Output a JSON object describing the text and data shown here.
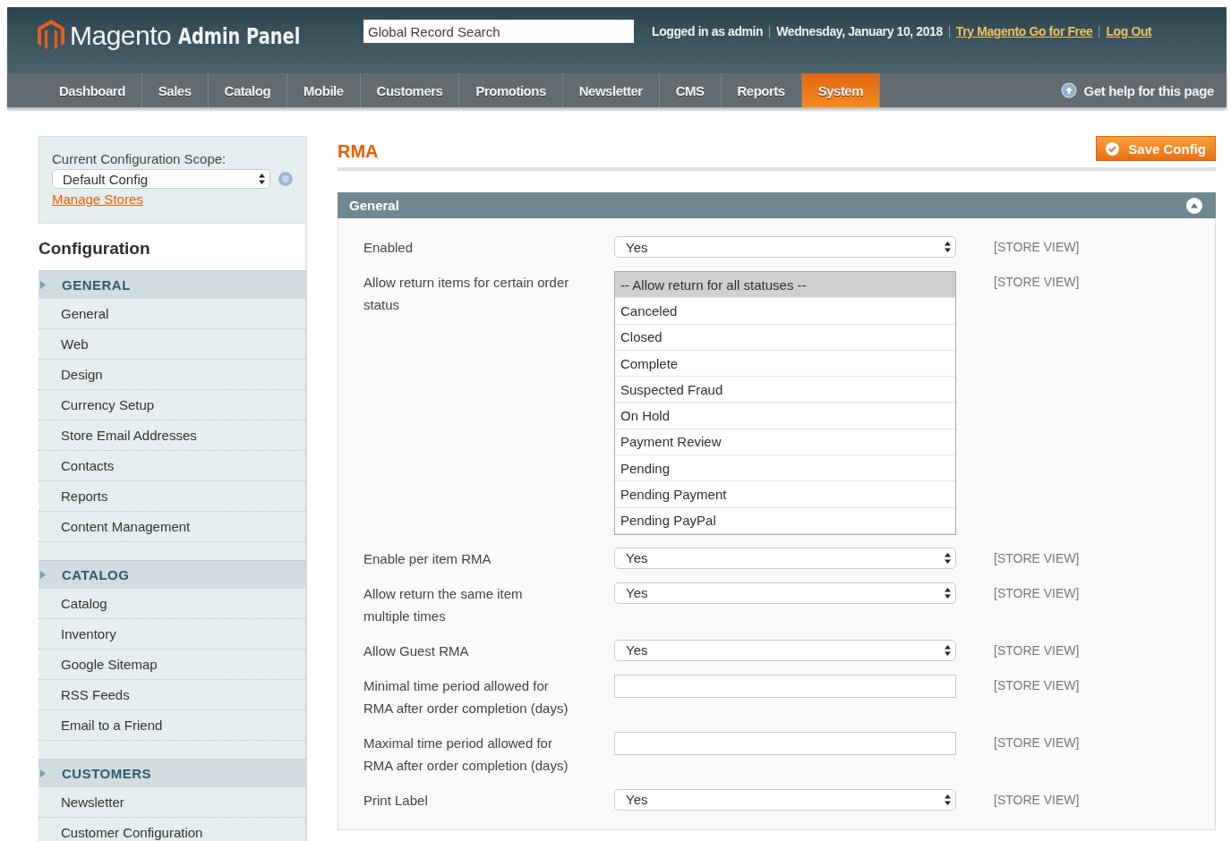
{
  "header": {
    "logo_word": "Magento",
    "logo_suffix": "Admin Panel",
    "search": {
      "placeholder": "Global Record Search"
    },
    "user": "Logged in as admin",
    "date": "Wednesday, January 10, 2018",
    "links": [
      "Try Magento Go for Free",
      "Log Out"
    ]
  },
  "nav": {
    "items": [
      {
        "label": "Dashboard",
        "selected": false
      },
      {
        "label": "Sales",
        "selected": false
      },
      {
        "label": "Catalog",
        "selected": false
      },
      {
        "label": "Mobile",
        "selected": false
      },
      {
        "label": "Customers",
        "selected": false
      },
      {
        "label": "Promotions",
        "selected": false
      },
      {
        "label": "Newsletter",
        "selected": false
      },
      {
        "label": "CMS",
        "selected": false
      },
      {
        "label": "Reports",
        "selected": false
      },
      {
        "label": "System",
        "selected": true
      }
    ],
    "help": "Get help for this page"
  },
  "sidebar": {
    "scope_label": "Current Configuration Scope:",
    "scope_value": "Default Config",
    "manage_link": "Manage Stores",
    "title": "Configuration",
    "sections": [
      {
        "title": "GENERAL",
        "items": [
          "General",
          "Web",
          "Design",
          "Currency Setup",
          "Store Email Addresses",
          "Contacts",
          "Reports",
          "Content Management"
        ]
      },
      {
        "title": "CATALOG",
        "items": [
          "Catalog",
          "Inventory",
          "Google Sitemap",
          "RSS Feeds",
          "Email to a Friend"
        ]
      },
      {
        "title": "CUSTOMERS",
        "items": [
          "Newsletter",
          "Customer Configuration"
        ]
      }
    ]
  },
  "page": {
    "title": "RMA",
    "save_button": "Save Config",
    "section": {
      "title": "General",
      "rows": [
        {
          "label": "Enabled",
          "kind": "select",
          "value": "Yes",
          "scope": "[STORE VIEW]"
        },
        {
          "label": "Allow return items for certain order status",
          "kind": "multiselect",
          "options": [
            {
              "label": "-- Allow return for all statuses --",
              "selected": true
            },
            {
              "label": "Canceled",
              "selected": false
            },
            {
              "label": "Closed",
              "selected": false
            },
            {
              "label": "Complete",
              "selected": false
            },
            {
              "label": "Suspected Fraud",
              "selected": false
            },
            {
              "label": "On Hold",
              "selected": false
            },
            {
              "label": "Payment Review",
              "selected": false
            },
            {
              "label": "Pending",
              "selected": false
            },
            {
              "label": "Pending Payment",
              "selected": false
            },
            {
              "label": "Pending PayPal",
              "selected": false
            }
          ],
          "scope": "[STORE VIEW]"
        },
        {
          "label": "Enable per item RMA",
          "kind": "select",
          "value": "Yes",
          "scope": "[STORE VIEW]"
        },
        {
          "label": "Allow return the same item multiple times",
          "kind": "select",
          "value": "Yes",
          "scope": "[STORE VIEW]"
        },
        {
          "label": "Allow Guest RMA",
          "kind": "select",
          "value": "Yes",
          "scope": "[STORE VIEW]"
        },
        {
          "label": "Minimal time period allowed for RMA after order completion (days)",
          "kind": "text",
          "scope": "[STORE VIEW]"
        },
        {
          "label": "Maximal time period allowed for RMA after order completion (days)",
          "kind": "text",
          "scope": "[STORE VIEW]"
        },
        {
          "label": "Print Label",
          "kind": "select",
          "value": "Yes",
          "scope": "[STORE VIEW]"
        }
      ]
    }
  }
}
